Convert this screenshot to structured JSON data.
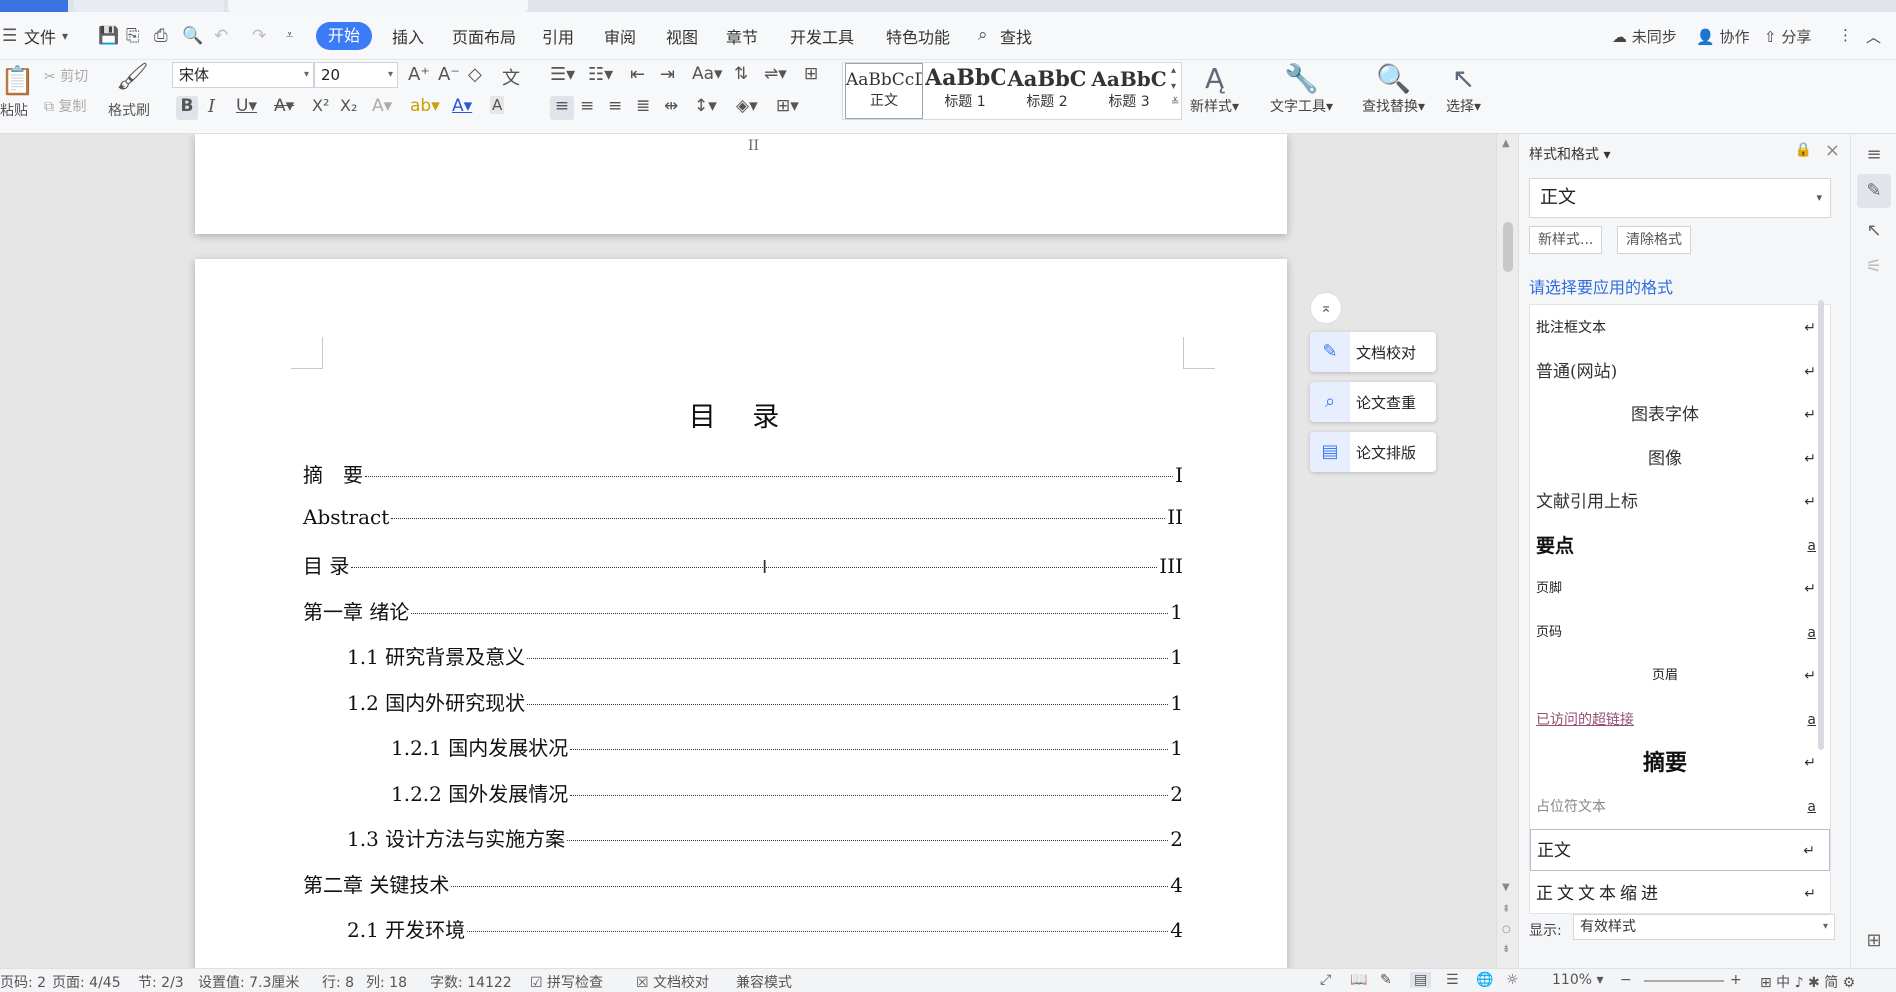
{
  "menu": {
    "file": "文件",
    "tabs": [
      "开始",
      "插入",
      "页面布局",
      "引用",
      "审阅",
      "视图",
      "章节",
      "开发工具",
      "特色功能"
    ],
    "search": "查找",
    "right": [
      "未同步",
      "协作",
      "分享"
    ]
  },
  "ribbon": {
    "paste": "粘贴",
    "cut": "剪切",
    "copy": "复制",
    "format_painter": "格式刷",
    "font_name": "宋体",
    "font_size": "20",
    "styles": [
      {
        "sample": "AaBbCcDd",
        "caption": "正文"
      },
      {
        "sample": "AaBbC",
        "caption": "标题 1"
      },
      {
        "sample": "AaBbC",
        "caption": "标题 2"
      },
      {
        "sample": "AaBbC",
        "caption": "标题 3"
      }
    ],
    "new_style": "新样式",
    "text_tools": "文字工具",
    "find_replace": "查找替换",
    "select": "选择"
  },
  "document": {
    "prev_page_number": "II",
    "toc_title": "目 录",
    "toc": [
      {
        "label": "摘　要",
        "page": "I",
        "level": 0
      },
      {
        "label": "Abstract",
        "page": "II",
        "level": 0
      },
      {
        "label": "目  录",
        "page": "III",
        "level": 0
      },
      {
        "label": "第一章  绪论",
        "page": "1",
        "level": 0
      },
      {
        "label": "1.1  研究背景及意义",
        "page": "1",
        "level": 1
      },
      {
        "label": "1.2  国内外研究现状",
        "page": "1",
        "level": 1
      },
      {
        "label": "1.2.1  国内发展状况",
        "page": "1",
        "level": 2
      },
      {
        "label": "1.2.2  国外发展情况",
        "page": "2",
        "level": 2
      },
      {
        "label": "1.3  设计方法与实施方案",
        "page": "2",
        "level": 1
      },
      {
        "label": "第二章  关键技术",
        "page": "4",
        "level": 0
      },
      {
        "label": "2.1  开发环境",
        "page": "4",
        "level": 1
      }
    ]
  },
  "float_tools": [
    "文档校对",
    "论文查重",
    "论文排版"
  ],
  "panel": {
    "title": "样式和格式",
    "current_style": "正文",
    "new_style_btn": "新样式...",
    "clear_format_btn": "清除格式",
    "hint": "请选择要应用的格式",
    "styles": [
      {
        "name": "批注框文本",
        "mark": "↵",
        "align": "left",
        "size": "14px",
        "bold": false,
        "color": "#222",
        "serif": false
      },
      {
        "name": "普通(网站)",
        "mark": "↵",
        "align": "left",
        "size": "17px",
        "bold": false,
        "color": "#333",
        "serif": true
      },
      {
        "name": "图表字体",
        "mark": "↵",
        "align": "center",
        "size": "17px",
        "bold": false,
        "color": "#333",
        "serif": true
      },
      {
        "name": "图像",
        "mark": "↵",
        "align": "center",
        "size": "17px",
        "bold": false,
        "color": "#333",
        "serif": true
      },
      {
        "name": "文献引用上标",
        "mark": "↵",
        "align": "left",
        "size": "17px",
        "bold": false,
        "color": "#333",
        "serif": true
      },
      {
        "name": "要点",
        "mark": "a",
        "align": "left",
        "size": "19px",
        "bold": true,
        "color": "#111",
        "serif": false
      },
      {
        "name": "页脚",
        "mark": "↵",
        "align": "left",
        "size": "13px",
        "bold": false,
        "color": "#222",
        "serif": false
      },
      {
        "name": "页码",
        "mark": "a",
        "align": "left",
        "size": "13px",
        "bold": false,
        "color": "#222",
        "serif": false
      },
      {
        "name": "页眉",
        "mark": "↵",
        "align": "center",
        "size": "13px",
        "bold": false,
        "color": "#222",
        "serif": false
      },
      {
        "name": "已访问的超链接",
        "mark": "a",
        "align": "left",
        "size": "14px",
        "bold": false,
        "color": "#954f72",
        "serif": false,
        "underline": true
      },
      {
        "name": "摘要",
        "mark": "↵",
        "align": "center",
        "size": "22px",
        "bold": true,
        "color": "#111",
        "serif": true
      },
      {
        "name": "占位符文本",
        "mark": "a",
        "align": "left",
        "size": "14px",
        "bold": false,
        "color": "#888",
        "serif": false
      },
      {
        "name": "正文",
        "mark": "↵",
        "align": "left",
        "size": "17px",
        "bold": false,
        "color": "#222",
        "serif": true,
        "selected": true
      },
      {
        "name": "正文文本缩进",
        "mark": "↵",
        "align": "left",
        "size": "17px",
        "bold": false,
        "color": "#222",
        "serif": true,
        "spaced": true
      }
    ],
    "show_label": "显示:",
    "show_value": "有效样式"
  },
  "status": [
    "页码: 2",
    "页面: 4/45",
    "节: 2/3",
    "设置值: 7.3厘米",
    "行: 8",
    "列: 18",
    "字数: 14122",
    "拼写检查",
    "文档校对",
    "兼容模式",
    "110%"
  ],
  "colors": {
    "accent": "#3c7bf6",
    "panel_link": "#2f6de1"
  }
}
